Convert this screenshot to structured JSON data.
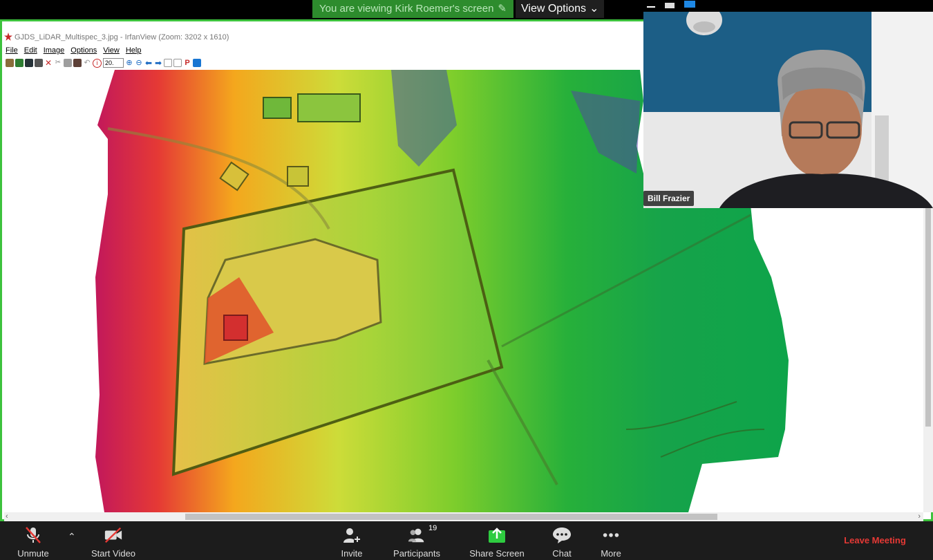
{
  "banner": {
    "message": "You are viewing Kirk Roemer's screen",
    "view_options": "View Options"
  },
  "window": {
    "title": "GJDS_LiDAR_Multispec_3.jpg - IrfanView (Zoom: 3202 x 1610)",
    "menu": [
      "File",
      "Edit",
      "Image",
      "Options",
      "View",
      "Help"
    ],
    "zoom_value": "20."
  },
  "participant": {
    "name": "Bill Frazier"
  },
  "controls": {
    "unmute": "Unmute",
    "start_video": "Start Video",
    "invite": "Invite",
    "participants": "Participants",
    "participants_count": "19",
    "share_screen": "Share Screen",
    "chat": "Chat",
    "more": "More",
    "leave": "Leave Meeting"
  },
  "colors": {
    "share_border": "#3dc23d",
    "leave": "#e53935",
    "share_icon": "#2ecc40"
  }
}
